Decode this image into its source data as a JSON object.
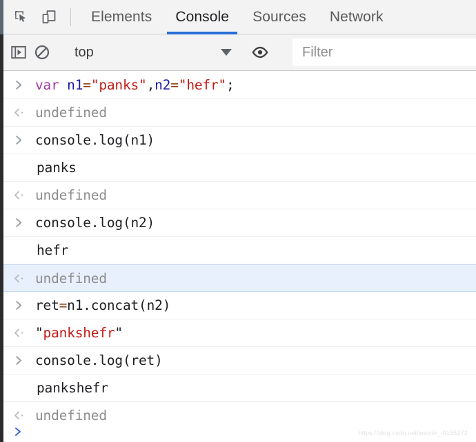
{
  "window": {
    "app": "Chrome DevTools",
    "panel": "Console"
  },
  "tabbar": {
    "inspect_icon": "inspect-element-icon",
    "device_icon": "device-toolbar-icon",
    "tabs": [
      {
        "label": "Elements",
        "active": false
      },
      {
        "label": "Console",
        "active": true
      },
      {
        "label": "Sources",
        "active": false
      },
      {
        "label": "Network",
        "active": false
      }
    ]
  },
  "console_toolbar": {
    "sidebar_toggle_icon": "console-sidebar-toggle-icon",
    "clear_icon": "clear-console-icon",
    "context": {
      "value": "top",
      "caret_icon": "chevron-down-icon"
    },
    "eye_icon": "live-expression-eye-icon",
    "filter": {
      "value": "",
      "placeholder": "Filter"
    }
  },
  "console": {
    "messages": [
      {
        "kind": "input",
        "gutter": "input-arrow-icon",
        "selected": false,
        "tokens": [
          {
            "text": "var ",
            "cls": "t-kw"
          },
          {
            "text": "n1",
            "cls": "t-var"
          },
          {
            "text": "=",
            "cls": "t-op"
          },
          {
            "text": "\"panks\"",
            "cls": "t-str"
          },
          {
            "text": ",",
            "cls": "t-punc"
          },
          {
            "text": "n2",
            "cls": "t-var"
          },
          {
            "text": "=",
            "cls": "t-op"
          },
          {
            "text": "\"hefr\"",
            "cls": "t-str"
          },
          {
            "text": ";",
            "cls": "t-punc"
          }
        ],
        "plain": "var n1=\"panks\",n2=\"hefr\";"
      },
      {
        "kind": "result",
        "gutter": "output-arrow-icon",
        "selected": false,
        "tokens": [
          {
            "text": "undefined",
            "cls": "t-undef"
          }
        ],
        "plain": "undefined"
      },
      {
        "kind": "input",
        "gutter": "input-arrow-icon",
        "selected": false,
        "tokens": [
          {
            "text": "console.log(n1)",
            "cls": "t-plain"
          }
        ],
        "plain": "console.log(n1)"
      },
      {
        "kind": "log",
        "gutter": "",
        "selected": false,
        "tokens": [
          {
            "text": "panks",
            "cls": "t-plain"
          }
        ],
        "plain": "panks"
      },
      {
        "kind": "result",
        "gutter": "output-arrow-icon",
        "selected": false,
        "tokens": [
          {
            "text": "undefined",
            "cls": "t-undef"
          }
        ],
        "plain": "undefined"
      },
      {
        "kind": "input",
        "gutter": "input-arrow-icon",
        "selected": false,
        "tokens": [
          {
            "text": "console.log(n2)",
            "cls": "t-plain"
          }
        ],
        "plain": "console.log(n2)"
      },
      {
        "kind": "log",
        "gutter": "",
        "selected": false,
        "tokens": [
          {
            "text": "hefr",
            "cls": "t-plain"
          }
        ],
        "plain": "hefr"
      },
      {
        "kind": "result",
        "gutter": "output-arrow-icon",
        "selected": true,
        "tokens": [
          {
            "text": "undefined",
            "cls": "t-undef"
          }
        ],
        "plain": "undefined"
      },
      {
        "kind": "input",
        "gutter": "input-arrow-icon",
        "selected": false,
        "tokens": [
          {
            "text": "ret",
            "cls": "t-plain"
          },
          {
            "text": "=",
            "cls": "t-op"
          },
          {
            "text": "n1.concat(n2)",
            "cls": "t-plain"
          }
        ],
        "plain": "ret=n1.concat(n2)"
      },
      {
        "kind": "result",
        "gutter": "output-arrow-icon",
        "selected": false,
        "tokens": [
          {
            "text": "\"",
            "cls": "t-punc"
          },
          {
            "text": "pankshefr",
            "cls": "t-str"
          },
          {
            "text": "\"",
            "cls": "t-punc"
          }
        ],
        "plain": "\"pankshefr\""
      },
      {
        "kind": "input",
        "gutter": "input-arrow-icon",
        "selected": false,
        "tokens": [
          {
            "text": "console.log(ret)",
            "cls": "t-plain"
          }
        ],
        "plain": "console.log(ret)"
      },
      {
        "kind": "log",
        "gutter": "",
        "selected": false,
        "tokens": [
          {
            "text": "pankshefr",
            "cls": "t-plain"
          }
        ],
        "plain": "pankshefr"
      },
      {
        "kind": "result",
        "gutter": "output-arrow-icon",
        "selected": false,
        "tokens": [
          {
            "text": "undefined",
            "cls": "t-undef"
          }
        ],
        "plain": "undefined"
      }
    ]
  },
  "prompt": {
    "arrow_icon": "prompt-arrow-icon",
    "value": ""
  },
  "watermark": {
    "text": "https://blog.csdn.net/weixin_-0155272"
  },
  "colors": {
    "accent_blue": "#2a6fd6",
    "selected_row_bg": "#e8f0fd",
    "selected_row_border": "#c6d9f5",
    "toolbar_bg": "#f3f3f3",
    "keyword": "#a33aa3",
    "variable": "#1a1aa6",
    "operator": "#8a3b12",
    "string": "#c41a16",
    "muted_text": "#8d8d8d"
  }
}
